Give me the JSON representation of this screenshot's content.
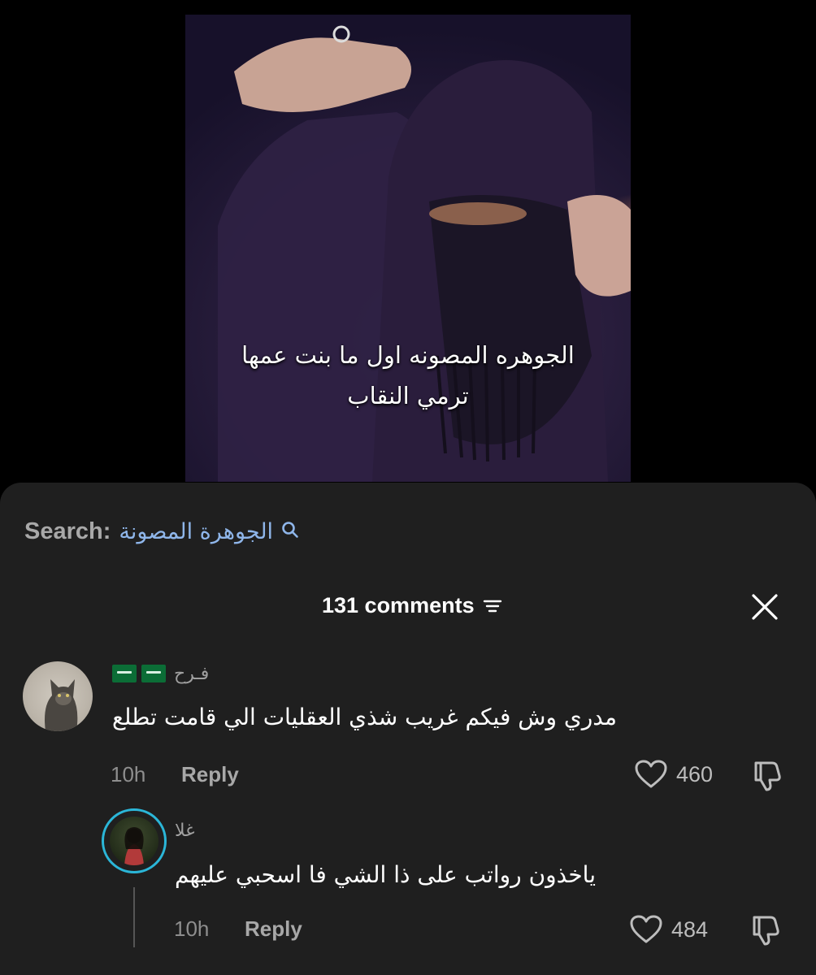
{
  "video": {
    "caption_line1": "الجوهره المصونه اول ما بنت عمها",
    "caption_line2": "ترمي النقاب"
  },
  "search": {
    "label": "Search:",
    "query": "الجوهرة المصونة",
    "icon": "search-icon"
  },
  "comments_header": {
    "count_label": "131 comments",
    "sort_icon": "filter-lines-icon",
    "close_icon": "close-icon"
  },
  "comments": [
    {
      "username": "فـرح",
      "text": "مدري وش فيكم غريب شذي العقليات الي قامت تطلع",
      "time": "10h",
      "reply_label": "Reply",
      "likes": "460"
    },
    {
      "username": "غلا",
      "text": "ياخذون رواتب على ذا الشي فا اسحبي عليهم",
      "time": "10h",
      "reply_label": "Reply",
      "likes": "484"
    }
  ],
  "colors": {
    "sheet_bg": "#1f1f1f",
    "search_query": "#8fb6ea",
    "story_ring": "#2bb6d8",
    "flag_green": "#0b6d36"
  }
}
